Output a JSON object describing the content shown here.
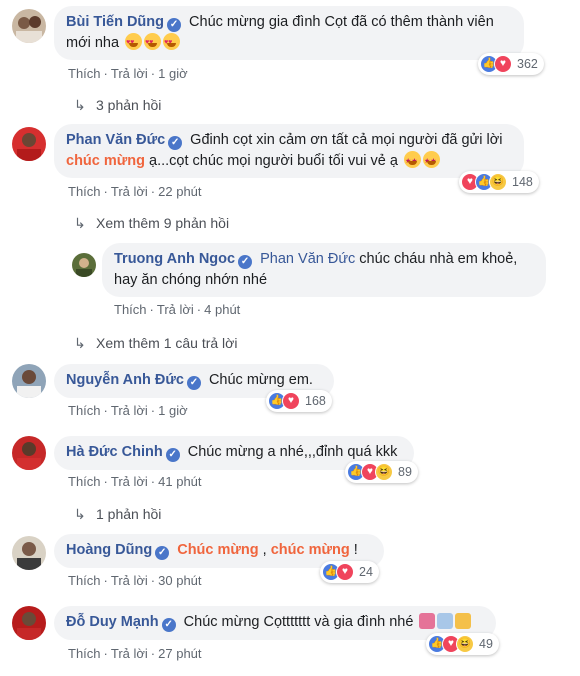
{
  "actions": {
    "like": "Thích",
    "reply": "Trả lời",
    "dot": "·"
  },
  "comments": [
    {
      "author": "Bùi Tiến Dũng",
      "text1": "Chúc mừng gia đình Cọt đã có thêm thành viên",
      "text2": "mới nha",
      "time": "1 giờ",
      "reactions": "362",
      "replies_link": "3 phản hồi"
    },
    {
      "author": "Phan Văn Đức",
      "text1": "Gđinh cọt xin cảm ơn tất cả mọi người đã gửi lời",
      "highlight": "chúc mừng",
      "text2": " ạ...cọt chúc mọi người buổi tối vui vẻ ạ",
      "time": "22 phút",
      "reactions": "148",
      "more_link": "Xem thêm 9 phản hồi"
    },
    {
      "author": "Truong Anh Ngoc",
      "mention": "Phan Văn Đức",
      "text1": " chúc cháu nhà em khoẻ,",
      "text2": "hay ăn chóng nhớn nhé",
      "time": "4 phút",
      "more_link": "Xem thêm 1 câu trả lời"
    },
    {
      "author": "Nguyễn Anh Đức",
      "text1": "Chúc mừng em.",
      "time": "1 giờ",
      "reactions": "168"
    },
    {
      "author": "Hà Đức Chinh",
      "text1": "Chúc mừng a nhé,,,đỉnh quá kkk",
      "time": "41 phút",
      "reactions": "89",
      "replies_link": "1 phản hồi"
    },
    {
      "author": "Hoàng Dũng",
      "highlight1": "Chúc mừng",
      "sep": " , ",
      "highlight2": "chúc mừng",
      "tail": " !",
      "time": "30 phút",
      "reactions": "24"
    },
    {
      "author": "Đỗ Duy Mạnh",
      "text1": "Chúc mừng Cọttttttt và gia đình nhé",
      "time": "27 phút",
      "reactions": "49"
    }
  ],
  "icons": {
    "arrow": "↳",
    "check": "✓"
  },
  "colors": {
    "link": "#385898",
    "highlight": "#f0653d",
    "bubble": "#f2f3f5",
    "like": "#4a7be0",
    "love": "#f0445c"
  }
}
